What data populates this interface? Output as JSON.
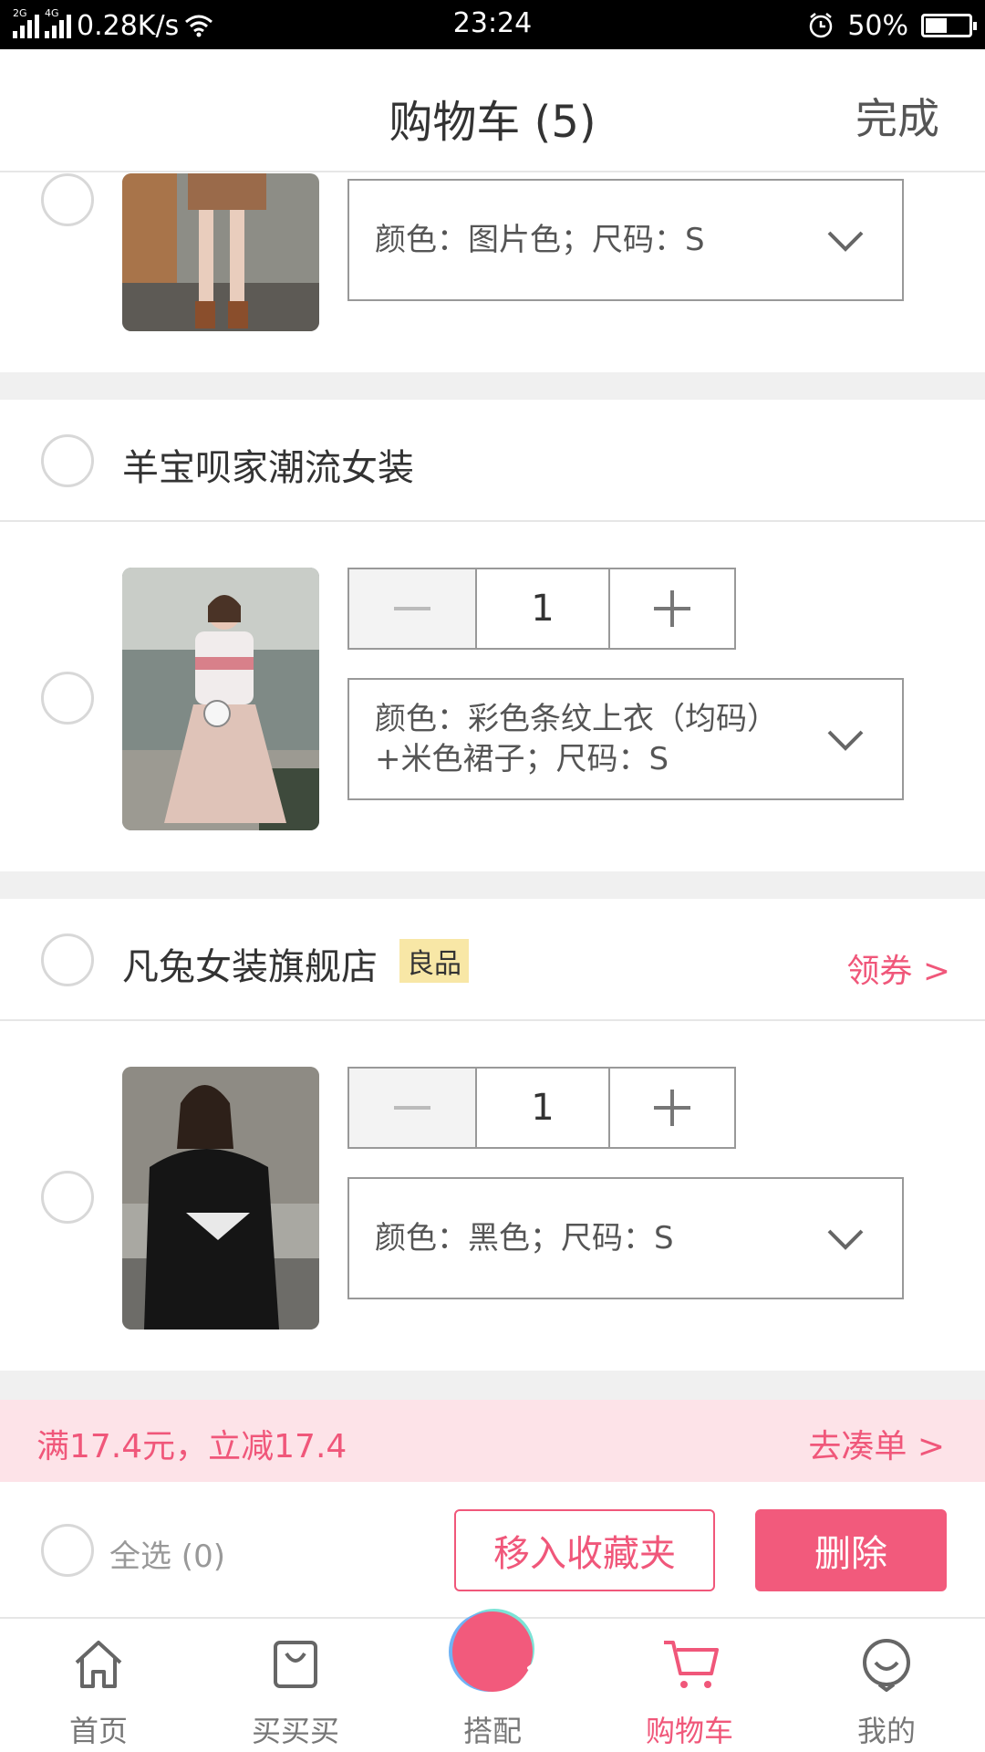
{
  "status_bar": {
    "net1": "2G",
    "net2": "4G",
    "speed": "0.28K/s",
    "time": "23:24",
    "battery": "50%",
    "battery_level": 0.5
  },
  "header": {
    "title": "购物车 (5)",
    "done": "完成"
  },
  "items": [
    {
      "spec": "颜色：图片色；尺码：S"
    },
    {
      "qty": "1",
      "spec": "颜色：彩色条纹上衣（均码）+米色裙子；尺码：S"
    },
    {
      "qty": "1",
      "spec": "颜色：黑色；尺码：S"
    }
  ],
  "shops": [
    {
      "name": "羊宝呗家潮流女装"
    },
    {
      "name": "凡兔女装旗舰店",
      "badge": "良品",
      "coupon": "领券 >"
    }
  ],
  "promo": {
    "text": "满17.4元，立减17.4",
    "link": "去凑单 >"
  },
  "bottom": {
    "select_all": "全选 (0)",
    "fav_button": "移入收藏夹",
    "delete_button": "删除"
  },
  "tabs": [
    "首页",
    "买买买",
    "搭配",
    "购物车",
    "我的"
  ],
  "colors": {
    "accent": "#f0577a",
    "promo_bg": "#fde3e8",
    "badge_bg": "#f8e7a6"
  }
}
